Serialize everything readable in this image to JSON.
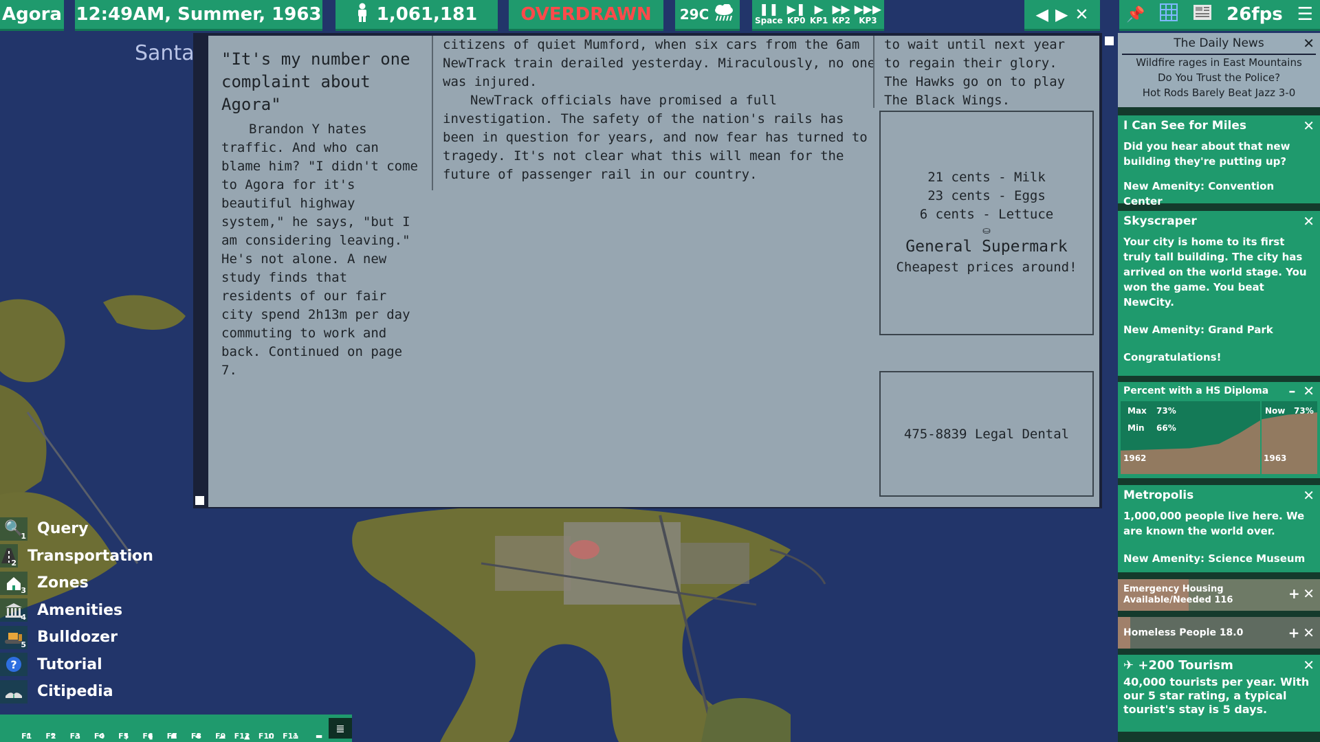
{
  "topbar": {
    "city": "Agora",
    "time": "12:49AM,  Summer,  1963",
    "population": "1,061,181",
    "status": "OVERDRAWN",
    "temperature": "29C",
    "speed_keys": [
      "Space",
      "KP0",
      "KP1",
      "KP2",
      "KP3"
    ],
    "fps": "26fps"
  },
  "map_label": "Santa",
  "newspaper": {
    "headline": "\"It's my number one complaint about Agora\"",
    "article1": "Brandon Y hates traffic. And who can blame him? \"I didn't come to Agora for it's beautiful highway system,\" he says, \"but I am considering leaving.\" He's not alone. A new study finds that residents of our fair city spend 2h13m per day commuting to work and back. Continued on page 7.",
    "article2_p1": "citizens of quiet Mumford, when six cars from the 6am NewTrack train derailed yesterday. Miraculously, no one was injured.",
    "article2_p2": "NewTrack officials have promised a full investigation. The safety of the nation's rails has been in question for years, and now fear has turned to tragedy. It's not clear what this will mean for the future of passenger rail in our country.",
    "article3": "to wait until next year to regain their glory. The Hawks go on to play The Black Wings.",
    "ad1": {
      "prices": [
        "21 cents - Milk",
        "23 cents - Eggs",
        "6 cents - Lettuce"
      ],
      "store": "General Supermark",
      "slogan": "Cheapest prices around!"
    },
    "ad2": "475-8839 Legal Dental"
  },
  "daily_news": {
    "title": "The Daily News",
    "headlines": [
      "Wildfire rages in East Mountains",
      "Do You Trust the Police?",
      "Hot Rods Barely Beat Jazz 3-0"
    ]
  },
  "cards": {
    "miles": {
      "title": "I Can See for Miles",
      "body": "Did you hear about that new building they're putting up?",
      "amenity": "New Amenity: Convention Center"
    },
    "skyscraper": {
      "title": "Skyscraper",
      "body": "Your city is home to its first truly tall building. The city has arrived on the world stage. You won the game. You beat NewCity.",
      "amenity": "New Amenity: Grand Park",
      "footer": "Congratulations!"
    },
    "chart": {
      "title": "Percent with a HS Diploma",
      "max_label": "Max",
      "max_value": "73%",
      "min_label": "Min",
      "min_value": "66%",
      "now_label": "Now",
      "now_value": "73%",
      "year_start": "1962",
      "year_end": "1963"
    },
    "metropolis": {
      "title": "Metropolis",
      "body": "1,000,000 people live here. We are known the world over.",
      "amenity": "New Amenity: Science Museum"
    },
    "emergency": {
      "line1": "Emergency Housing",
      "line2": "Available/Needed 116",
      "fill": 0.35
    },
    "homeless": {
      "label": "Homeless People 18.0",
      "fill": 0.06
    },
    "tourism": {
      "title": "+200 Tourism",
      "body": "40,000 tourists per year. With our 5 star rating, a typical tourist's stay is 5 days."
    }
  },
  "chart_data": {
    "type": "area",
    "title": "Percent with a HS Diploma",
    "x": [
      "1962",
      "1963"
    ],
    "max": 73,
    "min": 66,
    "now": 73
  },
  "menu": [
    {
      "label": "Query",
      "key": "1",
      "icon": "magnifier-icon"
    },
    {
      "label": "Transportation",
      "key": "2",
      "icon": "road-icon"
    },
    {
      "label": "Zones",
      "key": "3",
      "icon": "house-icon"
    },
    {
      "label": "Amenities",
      "key": "4",
      "icon": "building-icon"
    },
    {
      "label": "Bulldozer",
      "key": "5",
      "icon": "bulldozer-icon"
    },
    {
      "label": "Tutorial",
      "key": "",
      "icon": "question-icon"
    },
    {
      "label": "Citipedia",
      "key": "",
      "icon": "book-icon"
    }
  ],
  "fkeys": [
    "F1",
    "F2",
    "F3",
    "F4",
    "F5",
    "F6",
    "F7",
    "F8",
    "F9",
    "F12",
    "F10",
    "F11"
  ]
}
